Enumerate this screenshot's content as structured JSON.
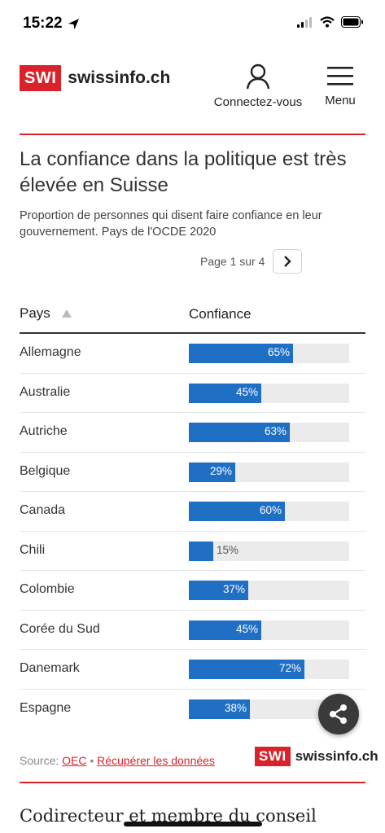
{
  "status_bar": {
    "time": "15:22"
  },
  "header": {
    "logo_badge": "SWI",
    "logo_text": "swissinfo.ch",
    "account_label": "Connectez-vous",
    "menu_label": "Menu"
  },
  "article": {
    "title": "La confiance dans la politique est très élevée en Suisse",
    "subtitle": "Proportion de personnes qui disent faire confiance en leur gouvernement. Pays de l'OCDE 2020",
    "pager_text": "Page 1 sur 4"
  },
  "table": {
    "col_country": "Pays",
    "col_value": "Confiance"
  },
  "chart_data": {
    "type": "bar",
    "orientation": "horizontal",
    "categories": [
      "Allemagne",
      "Australie",
      "Autriche",
      "Belgique",
      "Canada",
      "Chili",
      "Colombie",
      "Corée du Sud",
      "Danemark",
      "Espagne"
    ],
    "values": [
      65,
      45,
      63,
      29,
      60,
      15,
      37,
      45,
      72,
      38
    ],
    "labels": [
      "65%",
      "45%",
      "63%",
      "29%",
      "60%",
      "15%",
      "37%",
      "45%",
      "72%",
      "38%"
    ],
    "xlim": [
      0,
      100
    ],
    "bar_color": "#1f6fc5",
    "track_color": "#ebebeb"
  },
  "footer": {
    "source_prefix": "Source: ",
    "source_link": "OEC",
    "separator": " • ",
    "data_link": "Récupérer les données",
    "logo_badge": "SWI",
    "logo_text": "swissinfo.ch"
  },
  "next_article": {
    "title": "Codirecteur et membre du conseil"
  },
  "colors": {
    "brand_red": "#d8232a",
    "bar_blue": "#1f6fc5"
  }
}
